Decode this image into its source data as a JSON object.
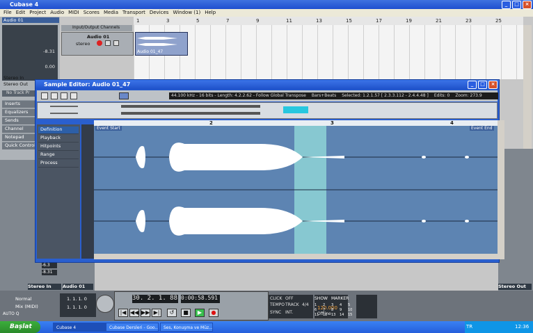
{
  "app": {
    "title": "Cubase 4"
  },
  "menu": [
    "File",
    "Edit",
    "Project",
    "Audio",
    "MIDI",
    "Scores",
    "Media",
    "Transport",
    "Devices",
    "Window (1)",
    "Help"
  ],
  "inspector": {
    "track_name": "Audio 01",
    "volume": "-8.31",
    "pan": "0.00",
    "stereo_in": "Stereo In",
    "stereo_out": "Stereo Out",
    "no_track_preset": "No Track Pr",
    "sections": [
      "Inserts",
      "Equalizers",
      "Sends",
      "Channel",
      "Notepad",
      "Quick Controls"
    ]
  },
  "track": {
    "folder": "Input/Output Channels",
    "name": "Audio 01",
    "type": "stereo",
    "event_label": "Audio 01_47"
  },
  "ruler_numbers": [
    "1",
    "3",
    "5",
    "7",
    "9",
    "11",
    "13",
    "15",
    "17",
    "19",
    "21",
    "23",
    "25"
  ],
  "sample_editor": {
    "title": "Sample Editor: Audio 01_47",
    "info": [
      "44.100 kHz - 16 bits - Length: 4.2.2.62 - Follow Global Transpose",
      "Bars+Beats",
      "Selected: 1.2.1.57 [ 2.3.3.112 - 2.4.4.48 ]",
      "Edits: 0",
      "Zoom: 273.9"
    ],
    "menu": [
      "Definition",
      "Playback",
      "Hitpoints",
      "Range",
      "Process"
    ],
    "ruler": [
      "2",
      "3",
      "4"
    ],
    "event_start": "Event Start",
    "event_end": "Event End"
  },
  "mixer": {
    "stereo_in": "Stereo In",
    "audio_ch": "Audio 01",
    "stereo_out": "Stereo Out",
    "level_in": "-8.31",
    "level_in_b": "-6.3"
  },
  "transport": {
    "left_locator": "1. 1. 1. 0",
    "right_locator": "1. 1. 1. 0",
    "mode_normal": "Normal",
    "mode_mix": "Mix (MIDI)",
    "auto_quant": "AUTO Q",
    "off": "OFF",
    "position_bars": "30. 2. 1. 88",
    "position_time": "0:00:58.591",
    "click": "CLICK",
    "tempo_label": "TEMPO",
    "track": "TRACK",
    "signature": "4/4",
    "tempo_value": "120.000",
    "sync": "SYNC",
    "int": "INT.",
    "offline": "Offline",
    "show": "SHOW",
    "marker": "MARKER",
    "markers": [
      "1",
      "2",
      "3",
      "4",
      "5",
      "6",
      "7",
      "8",
      "9",
      "10",
      "11",
      "12",
      "13",
      "14",
      "15"
    ]
  },
  "taskbar": {
    "start": "Başlat",
    "items": [
      "Cubase 4",
      "Cubase Dersleri - Goo...",
      "Ses, Konuşma ve Müz..."
    ],
    "lang": "TR",
    "clock": "12:36"
  }
}
